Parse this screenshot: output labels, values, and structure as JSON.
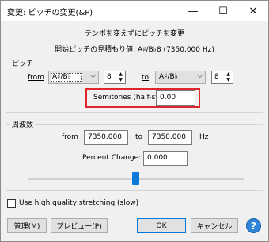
{
  "window": {
    "title": "変更: ピッチの変更(&P)",
    "min_glyph": "—",
    "max_glyph": "☐",
    "close_glyph": "✕"
  },
  "header": {
    "desc": "テンポを変えずにピッチを変更",
    "estimate": "開始ピッチの見積もり値: A♯/B♭8 (7350.000 Hz)"
  },
  "pitch": {
    "group_label": "ピッチ",
    "from_label": "from",
    "from_note": "A♯/B♭",
    "from_octave": "8",
    "to_label": "to",
    "to_note": "A♯/B♭",
    "to_octave": "8",
    "semitones_label": "Semitones (half-steps):",
    "semitones_value": "0.00"
  },
  "frequency": {
    "group_label": "周波数",
    "from_label": "from",
    "from_value": "7350.000",
    "to_label": "to",
    "to_value": "7350.000",
    "unit": "Hz",
    "percent_label": "Percent Change:",
    "percent_value": "0.000",
    "slider_fraction": 0.5
  },
  "options": {
    "high_quality_label": "Use high quality stretching (slow)",
    "high_quality_checked": false
  },
  "buttons": {
    "manage": "管理(M)",
    "preview": "プレビュー(P)",
    "ok": "OK",
    "cancel": "キャンセル",
    "help": "?"
  },
  "colors": {
    "highlight": "#e0252c",
    "accent": "#0b78d7"
  }
}
